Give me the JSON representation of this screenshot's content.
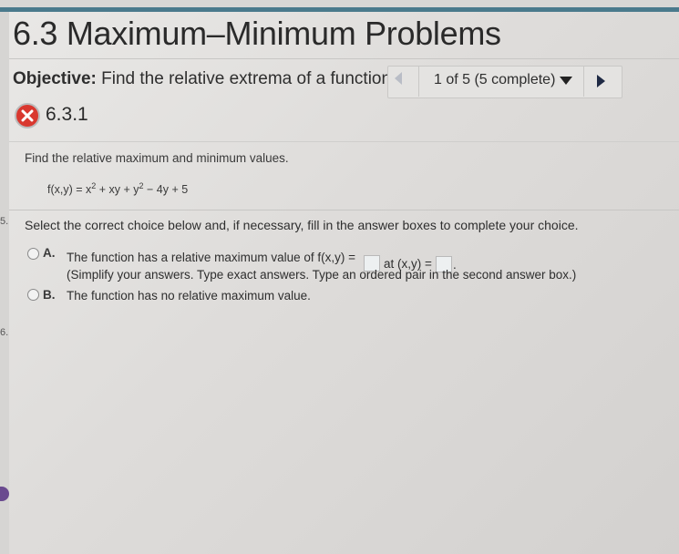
{
  "header": {
    "title": "6.3 Maximum–Minimum Problems"
  },
  "objective": {
    "label": "Objective:",
    "text": "Find the relative extrema of a function ..."
  },
  "navigator": {
    "position_text": "1 of 5 (5 complete)"
  },
  "question": {
    "status": "incorrect",
    "id": "6.3.1",
    "prompt": "Find the relative maximum and minimum values.",
    "function_text": "f(x,y) = x² + xy + y² − 4y + 5",
    "function_parts": {
      "lhs": "f(x,y) = x",
      "exp1": "2",
      "mid": " + xy + y",
      "exp2": "2",
      "rest": " − 4y + 5"
    }
  },
  "instructions": "Select the correct choice below and, if necessary, fill in the answer boxes to complete your choice.",
  "choices": [
    {
      "letter": "A.",
      "text_before": "The function has a relative maximum value of f(x,y) =",
      "text_middle": "at (x,y) =",
      "text_after": ".",
      "note": "(Simplify your answers. Type exact answers. Type an ordered pair in the second answer box.)",
      "answer1": "",
      "answer2": ""
    },
    {
      "letter": "B.",
      "text": "The function has no relative maximum value."
    }
  ],
  "gutter": {
    "mark1": "",
    "mark2": "5.",
    "mark3": "6."
  },
  "colors": {
    "accent": "#4a7a8c",
    "incorrect": "#d9382f",
    "gutter_pill": "#6a4a8f"
  }
}
